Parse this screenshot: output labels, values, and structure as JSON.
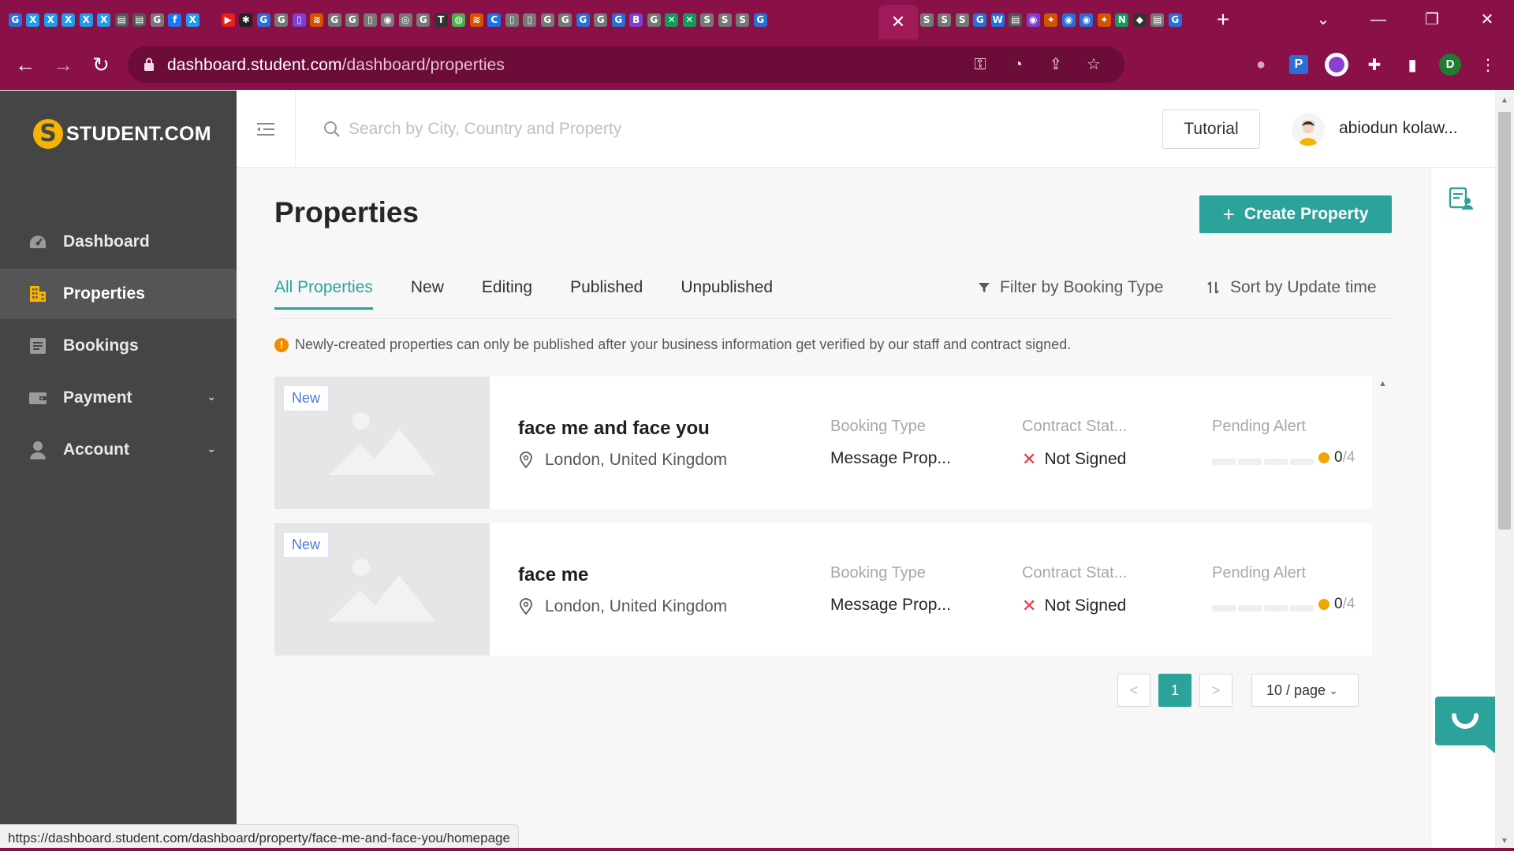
{
  "browser": {
    "url_host": "dashboard.student.com",
    "url_path": "/dashboard/properties",
    "active_tab_close": "✕",
    "new_tab": "+",
    "status_url": "https://dashboard.student.com/dashboard/property/face-me-and-face-you/homepage",
    "profile_initial": "D",
    "tab_favicons": [
      "G",
      "X",
      "X",
      "X",
      "X",
      "X",
      "▤",
      "▤",
      "G",
      "f",
      "X",
      "",
      "▶",
      "✱",
      "G",
      "G",
      "▯",
      "≋",
      "G",
      "G",
      "▯",
      "◉",
      "◎",
      "G",
      "T",
      "◍",
      "≋",
      "C",
      "▯",
      "▯",
      "G",
      "G",
      "G",
      "G",
      "G",
      "B",
      "G",
      "✕",
      "✕",
      "S",
      "S",
      "S",
      "G"
    ],
    "right_tab_favicons": [
      "S",
      "S",
      "S",
      "G",
      "W",
      "▤",
      "◉",
      "✦",
      "◉",
      "◉",
      "✦",
      "N",
      "◆",
      "▤",
      "G"
    ]
  },
  "brand": {
    "name": "STUDENT.COM"
  },
  "sidebar": {
    "items": [
      {
        "label": "Dashboard",
        "icon": "dashboard-icon",
        "active": false,
        "expandable": false
      },
      {
        "label": "Properties",
        "icon": "building-icon",
        "active": true,
        "expandable": false
      },
      {
        "label": "Bookings",
        "icon": "document-list-icon",
        "active": false,
        "expandable": false
      },
      {
        "label": "Payment",
        "icon": "wallet-icon",
        "active": false,
        "expandable": true
      },
      {
        "label": "Account",
        "icon": "user-icon",
        "active": false,
        "expandable": true
      }
    ]
  },
  "header": {
    "search_placeholder": "Search by City, Country and Property",
    "tutorial_label": "Tutorial",
    "username": "abiodun kolaw..."
  },
  "page": {
    "title": "Properties",
    "create_label": "Create Property",
    "tabs": [
      {
        "label": "All Properties",
        "active": true
      },
      {
        "label": "New",
        "active": false
      },
      {
        "label": "Editing",
        "active": false
      },
      {
        "label": "Published",
        "active": false
      },
      {
        "label": "Unpublished",
        "active": false
      }
    ],
    "filter_label": "Filter by Booking Type",
    "sort_label": "Sort by Update time",
    "notice": "Newly-created properties can only be published after your business information get verified by our staff and contract signed.",
    "notice_icon": "!"
  },
  "properties": [
    {
      "badge": "New",
      "name": "face me and face you",
      "location": "London, United Kingdom",
      "booking_type_label": "Booking Type",
      "booking_type": "Message Prop...",
      "contract_label": "Contract Stat...",
      "contract_status": "Not Signed",
      "alert_label": "Pending Alert",
      "alert_done": "0",
      "alert_total": "/4"
    },
    {
      "badge": "New",
      "name": "face me",
      "location": "London, United Kingdom",
      "booking_type_label": "Booking Type",
      "booking_type": "Message Prop...",
      "contract_label": "Contract Stat...",
      "contract_status": "Not Signed",
      "alert_label": "Pending Alert",
      "alert_done": "0",
      "alert_total": "/4"
    }
  ],
  "pagination": {
    "prev": "<",
    "current": "1",
    "next": ">",
    "page_size": "10 / page"
  },
  "colors": {
    "browser_chrome": "#8a1148",
    "sidebar_bg": "#454545",
    "accent": "#2ba39a",
    "brand_yellow": "#f5b400",
    "warning": "#f08c00",
    "danger": "#e8343d"
  }
}
